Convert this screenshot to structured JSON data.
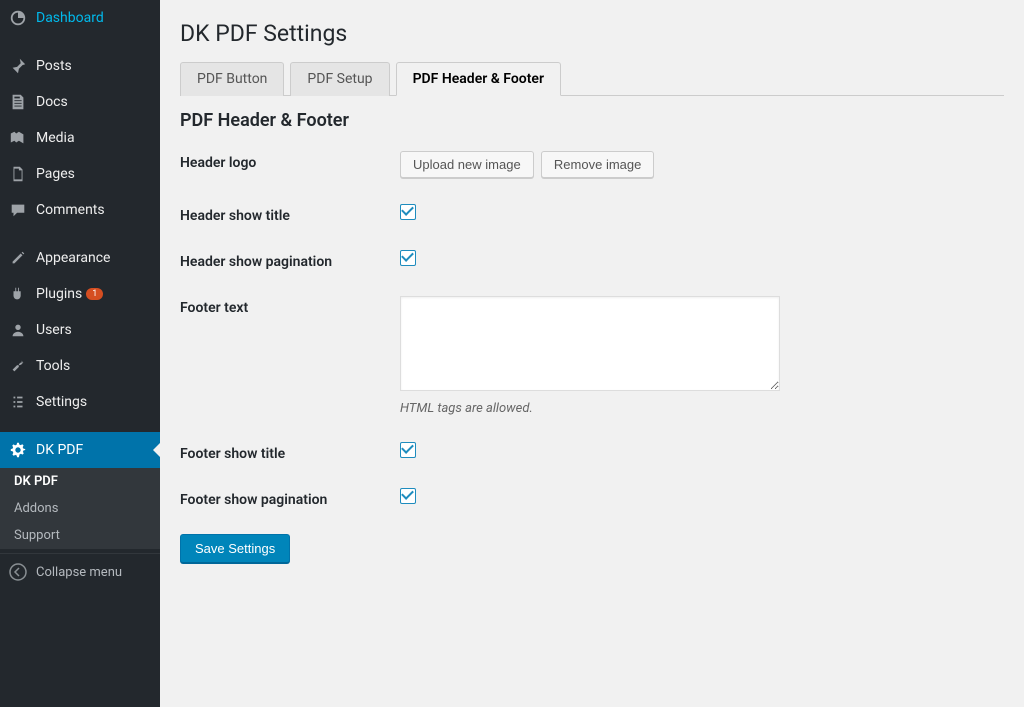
{
  "sidebar": {
    "items": [
      {
        "label": "Dashboard",
        "icon": "dashboard"
      },
      {
        "label": "Posts",
        "icon": "pin"
      },
      {
        "label": "Docs",
        "icon": "docs"
      },
      {
        "label": "Media",
        "icon": "media"
      },
      {
        "label": "Pages",
        "icon": "page"
      },
      {
        "label": "Comments",
        "icon": "comment"
      },
      {
        "label": "Appearance",
        "icon": "appearance"
      },
      {
        "label": "Plugins",
        "icon": "plugin",
        "badge": "1"
      },
      {
        "label": "Users",
        "icon": "user"
      },
      {
        "label": "Tools",
        "icon": "tools"
      },
      {
        "label": "Settings",
        "icon": "settings"
      },
      {
        "label": "DK PDF",
        "icon": "gear",
        "current": true
      }
    ],
    "submenu": [
      {
        "label": "DK PDF",
        "active": true
      },
      {
        "label": "Addons"
      },
      {
        "label": "Support"
      }
    ],
    "collapse_label": "Collapse menu"
  },
  "page": {
    "title": "DK PDF Settings",
    "tabs": [
      {
        "label": "PDF Button"
      },
      {
        "label": "PDF Setup"
      },
      {
        "label": "PDF Header & Footer",
        "active": true
      }
    ],
    "section_title": "PDF Header & Footer",
    "fields": {
      "header_logo_label": "Header logo",
      "upload_button": "Upload new image",
      "remove_button": "Remove image",
      "header_show_title_label": "Header show title",
      "header_show_title_checked": true,
      "header_show_pagination_label": "Header show pagination",
      "header_show_pagination_checked": true,
      "footer_text_label": "Footer text",
      "footer_text_value": "",
      "footer_text_description": "HTML tags are allowed.",
      "footer_show_title_label": "Footer show title",
      "footer_show_title_checked": true,
      "footer_show_pagination_label": "Footer show pagination",
      "footer_show_pagination_checked": true
    },
    "save_button": "Save Settings"
  }
}
